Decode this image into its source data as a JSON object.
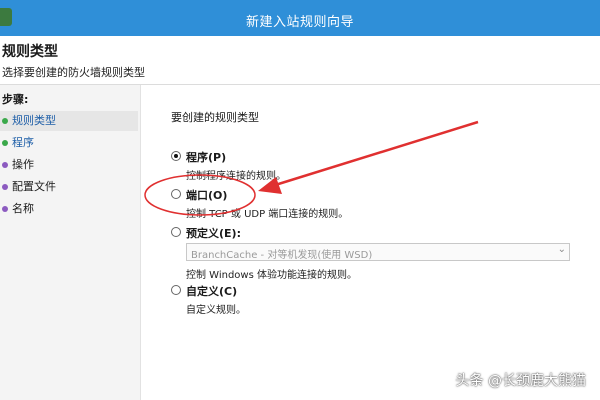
{
  "window": {
    "title": "新建入站规则向导"
  },
  "header": {
    "title": "规则类型",
    "subtitle": "选择要创建的防火墙规则类型"
  },
  "steps": {
    "title": "步骤:",
    "items": [
      {
        "label": "规则类型",
        "state": "done",
        "active": true
      },
      {
        "label": "程序",
        "state": "done",
        "active": false
      },
      {
        "label": "操作",
        "state": "pending",
        "active": false
      },
      {
        "label": "配置文件",
        "state": "pending",
        "active": false
      },
      {
        "label": "名称",
        "state": "pending",
        "active": false
      }
    ]
  },
  "main": {
    "prompt": "要创建的规则类型",
    "options": [
      {
        "label": "程序(P)",
        "desc": "控制程序连接的规则。",
        "checked": true
      },
      {
        "label": "端口(O)",
        "desc": "控制 TCP 或 UDP 端口连接的规则。",
        "checked": false
      },
      {
        "label": "预定义(E):",
        "dropdown_value": "BranchCache - 对等机发现(使用 WSD)",
        "desc": "控制 Windows 体验功能连接的规则。",
        "checked": false
      },
      {
        "label": "自定义(C)",
        "desc": "自定义规则。",
        "checked": false
      }
    ]
  },
  "watermark": "头条 @长颈鹿大熊猫",
  "colors": {
    "titlebar": "#2f8fd8",
    "annotation": "#e03030",
    "step_done": "#3aa84a",
    "step_pending": "#8c5bc0"
  },
  "icons": {
    "window_icon": "firewall-icon",
    "dropdown_chevron": "chevron-down-icon"
  }
}
